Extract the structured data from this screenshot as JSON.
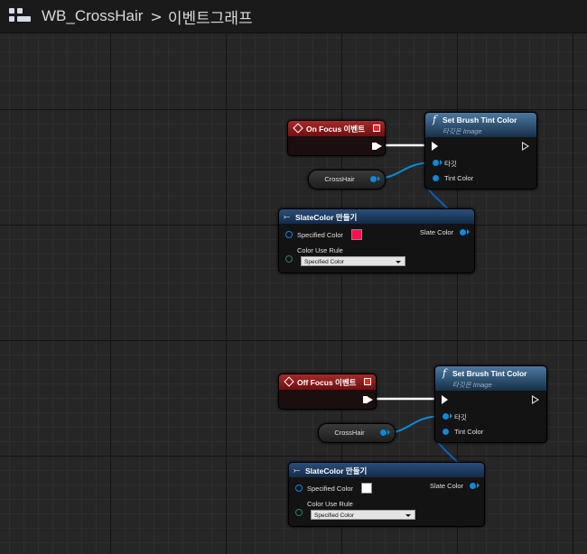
{
  "breadcrumb": {
    "blueprint": "WB_CrossHair",
    "separator": ">",
    "graph": "이벤트그래프"
  },
  "graph1": {
    "event_title": "On Focus 이벤트",
    "function_title": "Set Brush Tint Color",
    "function_subtitle": "타깃은 Image",
    "pin_target": "타깃",
    "pin_tint": "Tint Color",
    "variable": "CrossHair",
    "make_title": "SlateColor 만들기",
    "specified_color": "Specified Color",
    "specified_color_value": "#ff0f4f",
    "color_use_rule": "Color Use Rule",
    "color_use_rule_value": "Specified Color",
    "slate_color": "Slate Color"
  },
  "graph2": {
    "event_title": "Off Focus 이벤트",
    "function_title": "Set Brush Tint Color",
    "function_subtitle": "타깃은 Image",
    "pin_target": "타깃",
    "pin_tint": "Tint Color",
    "variable": "CrossHair",
    "make_title": "SlateColor 만들기",
    "specified_color": "Specified Color",
    "specified_color_value": "#ffffff",
    "color_use_rule": "Color Use Rule",
    "color_use_rule_value": "Specified Color",
    "slate_color": "Slate Color"
  },
  "colors": {
    "event_header": "#a52a2a",
    "function_header": "#4c78a0",
    "object_pin": "#0a8ad8",
    "exec_wire": "#ffffff"
  }
}
